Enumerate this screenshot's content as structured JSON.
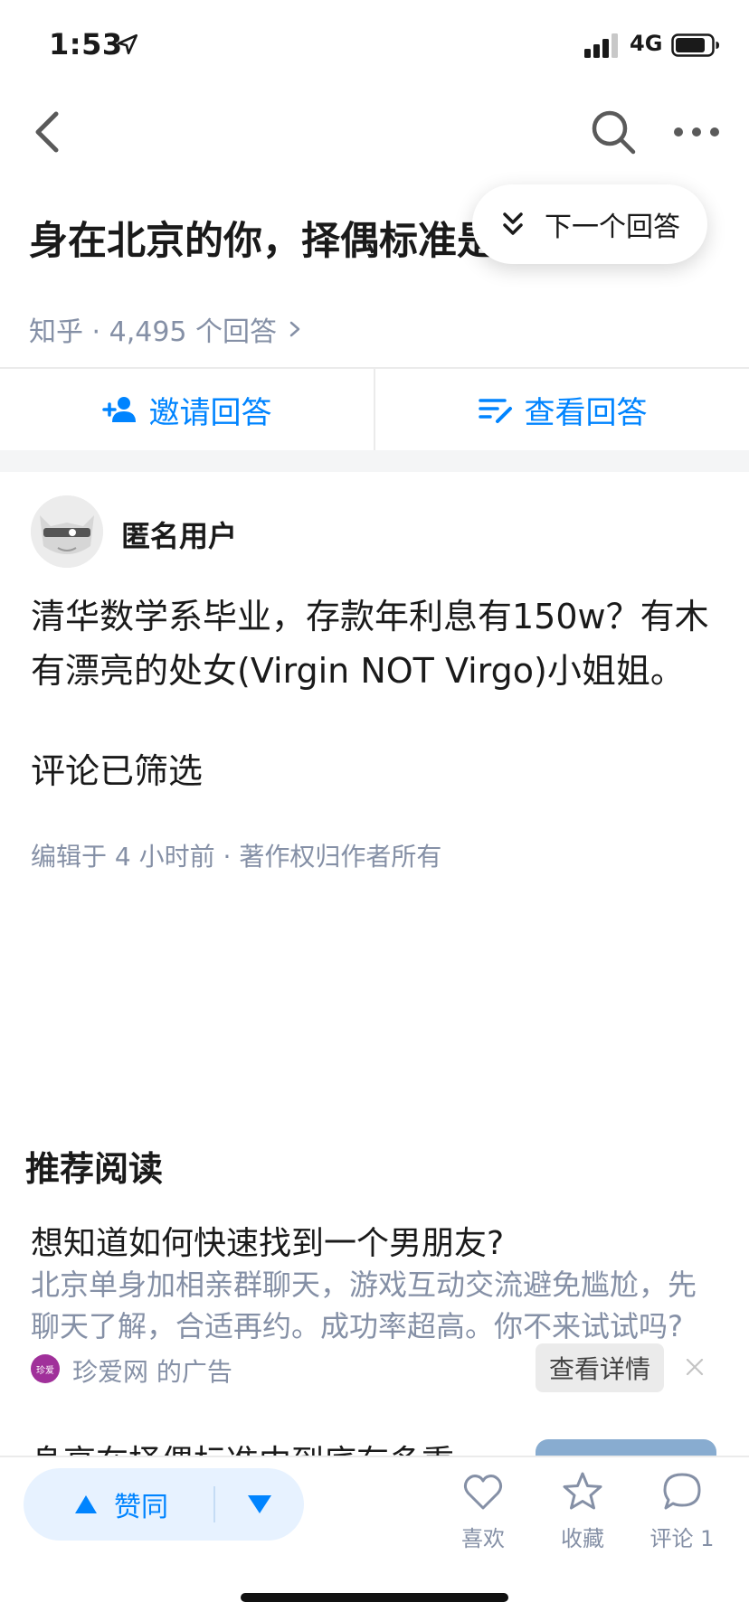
{
  "status_bar": {
    "time": "1:53",
    "network": "4G"
  },
  "nav": {
    "icons": [
      "back-icon",
      "search-icon",
      "more-icon"
    ]
  },
  "question": {
    "title": "身在北京的你，择偶标准是什么？",
    "source": "知乎 · 4,495 个回答"
  },
  "next_answer": {
    "label": "下一个回答"
  },
  "actions": {
    "invite_label": "邀请回答",
    "view_label": "查看回答"
  },
  "answer": {
    "author": "匿名用户",
    "text": "清华数学系毕业，存款年利息有150w？有木有漂亮的处女(Virgin NOT Virgo)小姐姐。",
    "comment_note": "评论已筛选",
    "edit_meta": "编辑于 4 小时前 · 著作权归作者所有"
  },
  "recommended": {
    "heading": "推荐阅读",
    "ad": {
      "title": "想知道如何快速找到一个男朋友?",
      "description": "北京单身加相亲群聊天，游戏互动交流避免尴尬，先聊天了解，合适再约。成功率超高。你不来试试吗?",
      "logo_text": "珍爱",
      "source": "珍爱网 的广告",
      "detail_label": "查看详情"
    },
    "next_title": "身高在择偶标准中到底有多重"
  },
  "bottom_bar": {
    "vote_label": "赞同",
    "like_label": "喜欢",
    "collect_label": "收藏",
    "comment_label": "评论 1"
  },
  "colors": {
    "accent": "#0084ff",
    "vote_bg": "#e7f2ff",
    "meta_gray": "#8590a6"
  }
}
